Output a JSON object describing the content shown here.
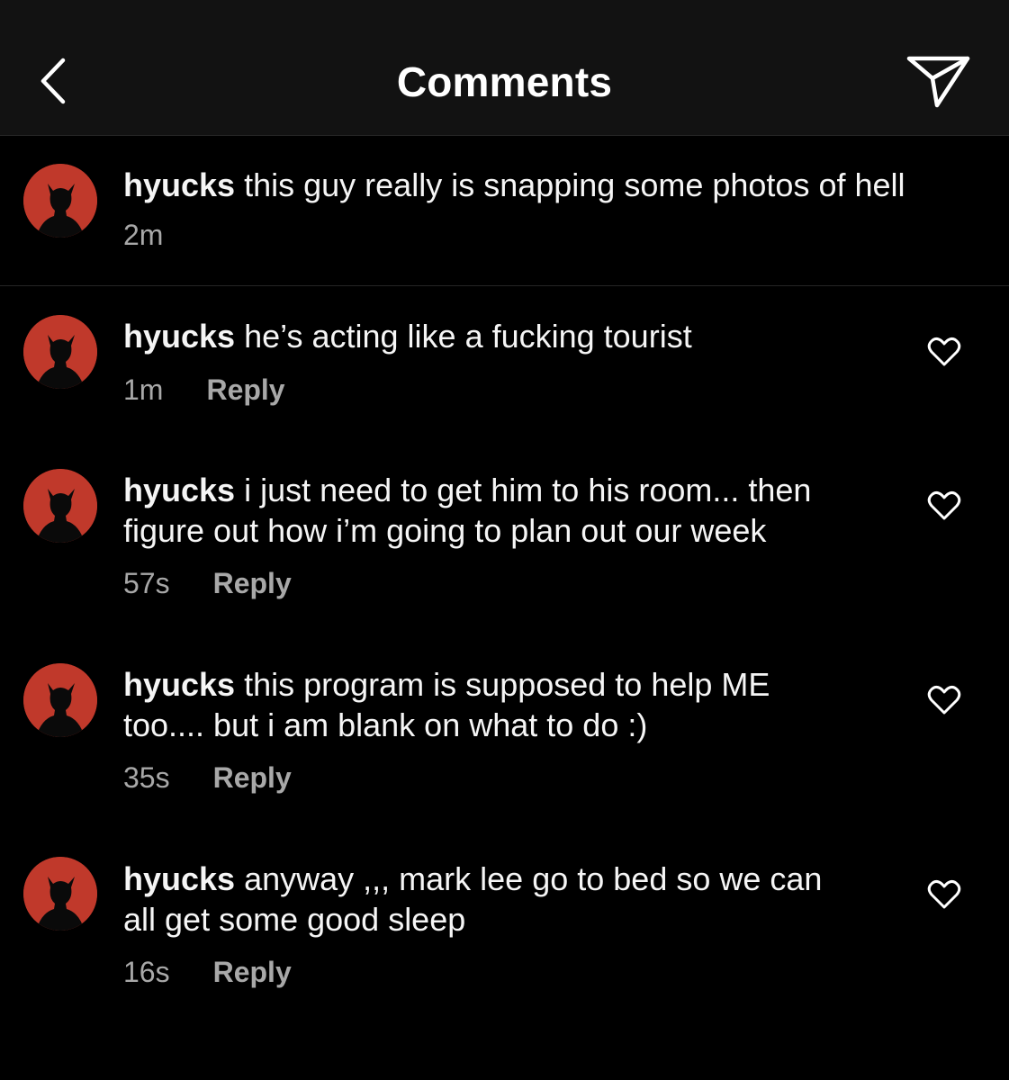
{
  "header": {
    "title": "Comments",
    "back_icon": "chevron-left-icon",
    "share_icon": "paper-plane-icon"
  },
  "caption": {
    "username": "hyucks",
    "text": "this guy really is snapping some photos of hell",
    "time": "2m"
  },
  "comments": [
    {
      "username": "hyucks",
      "lines": [
        "he’s acting like a fucking tourist"
      ],
      "time": "1m",
      "reply_label": "Reply"
    },
    {
      "username": "hyucks",
      "lines": [
        "i just need to get him to his room... then",
        "figure out how i’m going to plan out our week"
      ],
      "time": "57s",
      "reply_label": "Reply"
    },
    {
      "username": "hyucks",
      "lines": [
        "this program is supposed to help ME",
        "too.... but i am blank on what to do :)"
      ],
      "time": "35s",
      "reply_label": "Reply"
    },
    {
      "username": "hyucks",
      "lines": [
        "anyway ,,, mark lee go to bed so we can",
        "all get some good sleep"
      ],
      "time": "16s",
      "reply_label": "Reply"
    }
  ],
  "colors": {
    "background": "#000000",
    "header": "#121212",
    "avatar": "#c0392b",
    "muted_text": "#a8a8a8"
  }
}
